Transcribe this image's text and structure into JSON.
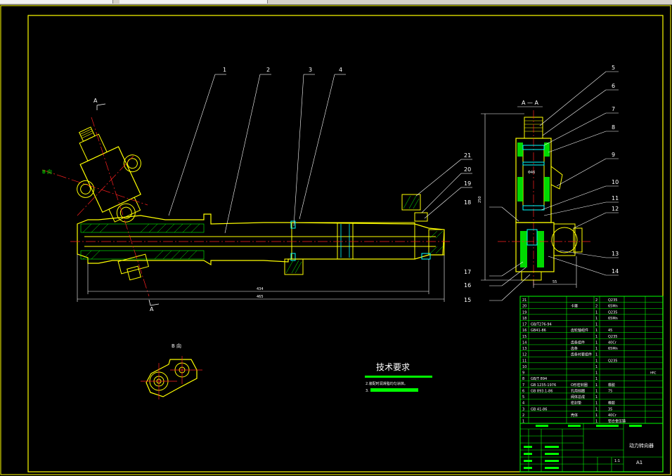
{
  "drawing": {
    "part_numbers_top": [
      "1",
      "2",
      "3",
      "4"
    ],
    "part_numbers_right": [
      "5",
      "6",
      "7",
      "8",
      "9",
      "10",
      "11",
      "12",
      "13",
      "14",
      "15",
      "16",
      "17",
      "18",
      "19",
      "20",
      "21"
    ],
    "section_label": "A — A",
    "view_label_left": "B 向",
    "view_label_bottom": "B 向",
    "cut_mark": "A",
    "dim_overall": "465",
    "dim_inner": "434",
    "dim_right_bottom": "55",
    "dim_vertical": "250",
    "dim_bore": "Φ46"
  },
  "tech_req": {
    "title": "技术要求",
    "lines": [
      "2.装配时润滑脂均匀涂抹。",
      "3."
    ]
  },
  "bom": {
    "rows": [
      {
        "no": "21",
        "code": "",
        "name": "",
        "qty": "2",
        "mat": "Q235"
      },
      {
        "no": "20",
        "code": "",
        "name": "卡箍",
        "qty": "2",
        "mat": "65Mn"
      },
      {
        "no": "19",
        "code": "",
        "name": "",
        "qty": "1",
        "mat": "Q235"
      },
      {
        "no": "18",
        "code": "",
        "name": "",
        "qty": "1",
        "mat": "65Mn"
      },
      {
        "no": "17",
        "code": "GB/T276-94",
        "name": "",
        "qty": "1",
        "mat": ""
      },
      {
        "no": "16",
        "code": "GB41-86",
        "name": "齿轮轴组件",
        "qty": "1",
        "mat": "45"
      },
      {
        "no": "15",
        "code": "",
        "name": "",
        "qty": "1",
        "mat": "Q235"
      },
      {
        "no": "14",
        "code": "",
        "name": "齿条组件",
        "qty": "1",
        "mat": "40Cr"
      },
      {
        "no": "13",
        "code": "",
        "name": "齿条",
        "qty": "1",
        "mat": "65Mn"
      },
      {
        "no": "12",
        "code": "",
        "name": "齿条衬套组件",
        "qty": "1",
        "mat": ""
      },
      {
        "no": "11",
        "code": "",
        "name": "",
        "qty": "1",
        "mat": "Q235"
      },
      {
        "no": "10",
        "code": "",
        "name": "",
        "qty": "1",
        "mat": ""
      },
      {
        "no": "9",
        "code": "",
        "name": "",
        "qty": "1",
        "mat": ""
      },
      {
        "no": "8",
        "code": "GB/T 894",
        "name": "",
        "qty": "1",
        "mat": ""
      },
      {
        "no": "7",
        "code": "GB 1235-1976",
        "name": "O形密封圈",
        "qty": "1",
        "mat": "橡胶"
      },
      {
        "no": "6",
        "code": "GB 893.1-86",
        "name": "孔用挡圈",
        "qty": "1",
        "mat": "75"
      },
      {
        "no": "5",
        "code": "",
        "name": "阀体总成",
        "qty": "1",
        "mat": ""
      },
      {
        "no": "4",
        "code": "",
        "name": "密封垫",
        "qty": "1",
        "mat": "橡胶"
      },
      {
        "no": "3",
        "code": "GB 41-86",
        "name": "",
        "qty": "1",
        "mat": "35"
      },
      {
        "no": "2",
        "code": "",
        "name": "壳体",
        "qty": "1",
        "mat": "40Cr"
      },
      {
        "no": "1",
        "code": "",
        "name": "",
        "qty": "1",
        "mat": "铝合金压铸"
      }
    ],
    "extra_mark": "HRC"
  },
  "title_block": {
    "name": "动力转向器",
    "scale": "1:1",
    "sheet": "A1"
  },
  "colors": {
    "frame": "#ffff00",
    "part": "#ffff00",
    "hatch": "#00ff00",
    "leader": "#ffffff",
    "center": "#ff2020",
    "cyan": "#00ffff",
    "table": "#00ff00"
  }
}
